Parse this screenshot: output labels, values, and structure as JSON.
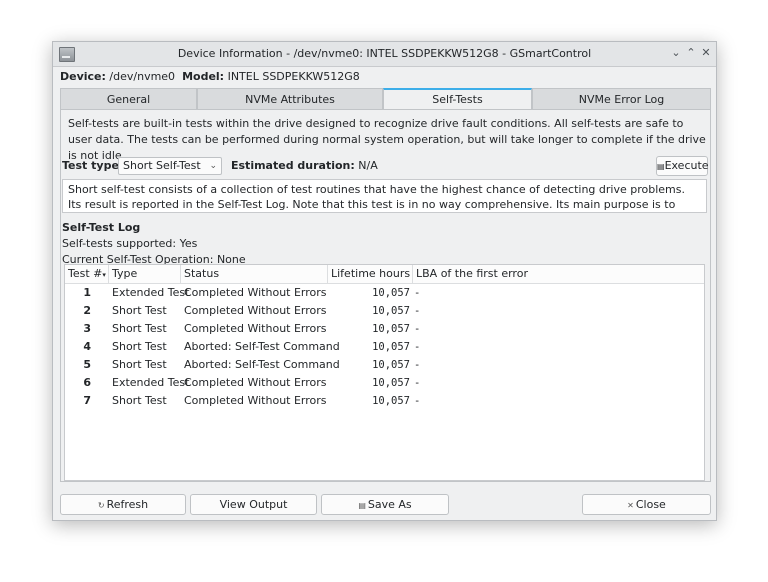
{
  "window": {
    "title": "Device Information - /dev/nvme0: INTEL SSDPEKKW512G8 - GSmartControl"
  },
  "device_line": {
    "device_label": "Device:",
    "device_value": "/dev/nvme0",
    "model_label": "Model:",
    "model_value": "INTEL SSDPEKKW512G8"
  },
  "tabs": [
    {
      "label": "General"
    },
    {
      "label": "NVMe Attributes"
    },
    {
      "label": "Self-Tests"
    },
    {
      "label": "NVMe Error Log"
    }
  ],
  "intro_text": "Self-tests are built-in tests within the drive designed to recognize drive fault conditions. All self-tests are safe to user data. The tests can be performed during normal system operation, but will take longer to complete if the drive is not idle.",
  "test_type": {
    "label": "Test type:",
    "selected": "Short Self-Test",
    "duration_label": "Estimated duration:",
    "duration_value": "N/A",
    "execute_label": "Execute"
  },
  "description": "Short self-test consists of a collection of test routines that have the highest chance of detecting drive problems. Its result is reported in the Self-Test Log. Note that this test is in no way comprehensive. Its main purpose is to detect totally damaged drives without running a full surface scan.",
  "log": {
    "heading": "Self-Test Log",
    "supported": "Self-tests supported: Yes",
    "current_op": "Current Self-Test Operation: None"
  },
  "table": {
    "headers": [
      "Test #",
      "Type",
      "Status",
      "Lifetime hours",
      "LBA of the first error"
    ],
    "rows": [
      {
        "num": "1",
        "type": "Extended Test",
        "status": "Completed Without Errors",
        "hours": "10,057",
        "lba": "-"
      },
      {
        "num": "2",
        "type": "Short Test",
        "status": "Completed Without Errors",
        "hours": "10,057",
        "lba": "-"
      },
      {
        "num": "3",
        "type": "Short Test",
        "status": "Completed Without Errors",
        "hours": "10,057",
        "lba": "-"
      },
      {
        "num": "4",
        "type": "Short Test",
        "status": "Aborted: Self-Test Command",
        "hours": "10,057",
        "lba": "-"
      },
      {
        "num": "5",
        "type": "Short Test",
        "status": "Aborted: Self-Test Command",
        "hours": "10,057",
        "lba": "-"
      },
      {
        "num": "6",
        "type": "Extended Test",
        "status": "Completed Without Errors",
        "hours": "10,057",
        "lba": "-"
      },
      {
        "num": "7",
        "type": "Short Test",
        "status": "Completed Without Errors",
        "hours": "10,057",
        "lba": "-"
      }
    ]
  },
  "footer": {
    "refresh": "Refresh",
    "view_output": "View Output",
    "save_as": "Save As",
    "close": "Close"
  },
  "colors": {
    "accent": "#3daee9",
    "window_bg": "#eff0f1"
  }
}
